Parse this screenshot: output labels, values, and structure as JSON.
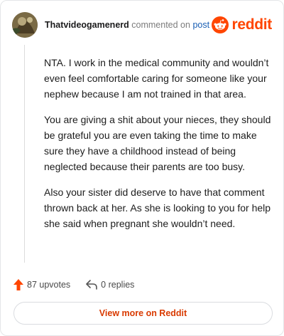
{
  "header": {
    "username": "Thatvideogamenerd",
    "commented_on": "commented on",
    "post_link": "post",
    "brand": "reddit"
  },
  "comment": {
    "paragraphs": [
      "NTA. I work in the medical community and wouldn’t even feel comfortable caring for someone like your nephew because I am not trained in that area.",
      "You are giving a shit about your nieces, they should be grateful you are even taking the time to make sure they have a childhood instead of being neglected because their parents are too busy.",
      "Also your sister did deserve to have that comment thrown back at her. As she is looking to you for help she said when pregnant she wouldn’t need."
    ]
  },
  "actions": {
    "upvotes": "87 upvotes",
    "replies": "0 replies"
  },
  "footer": {
    "view_more": "View more on Reddit"
  },
  "colors": {
    "brand": "#ff4500",
    "link": "#1a5fb4",
    "view_more": "#d93a00"
  },
  "icons": {
    "avatar": "user-avatar",
    "logo": "reddit-snoo-icon",
    "upvote": "upvote-arrow-icon",
    "reply": "reply-icon"
  }
}
